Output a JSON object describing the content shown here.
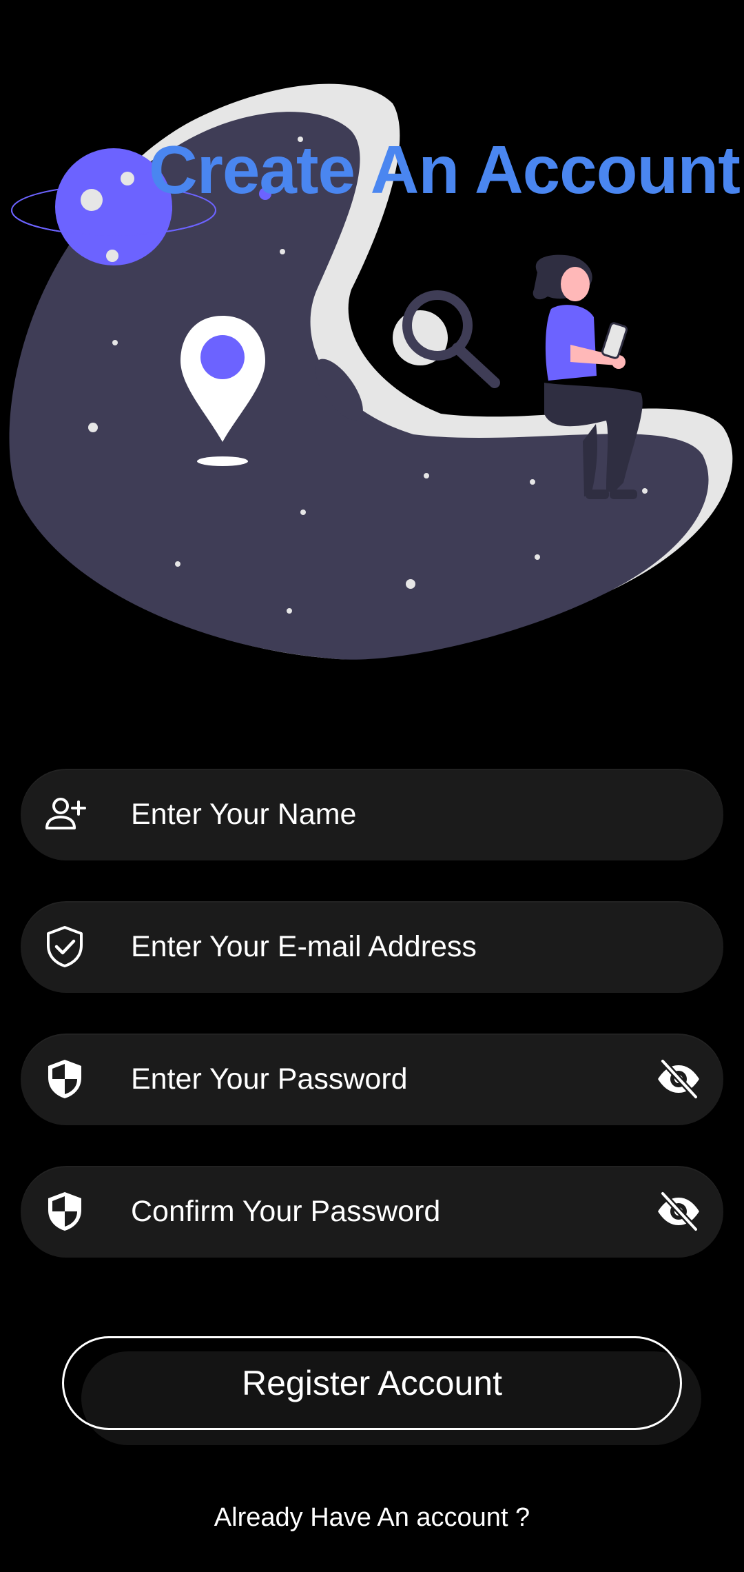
{
  "header": {
    "title": "Create An Account"
  },
  "form": {
    "fields": [
      {
        "name": "name",
        "placeholder": "Enter Your Name",
        "icon": "add-person-icon"
      },
      {
        "name": "email",
        "placeholder": "Enter Your E-mail Address",
        "icon": "verified-shield-icon"
      },
      {
        "name": "password",
        "placeholder": "Enter Your Password",
        "icon": "shield-icon",
        "trailing_icon": "visibility-off-icon"
      },
      {
        "name": "confirm_password",
        "placeholder": "Confirm Your Password",
        "icon": "shield-icon",
        "trailing_icon": "visibility-off-icon"
      }
    ],
    "register_label": "Register Account",
    "signin_link": "Already Have An account ?"
  },
  "colors": {
    "background": "#000000",
    "title": "#4a86f0",
    "field_background": "#1b1b1b",
    "illustration_blob": "#3f3d56",
    "illustration_accent": "#6c63ff",
    "illustration_light": "#e6e6e6"
  }
}
